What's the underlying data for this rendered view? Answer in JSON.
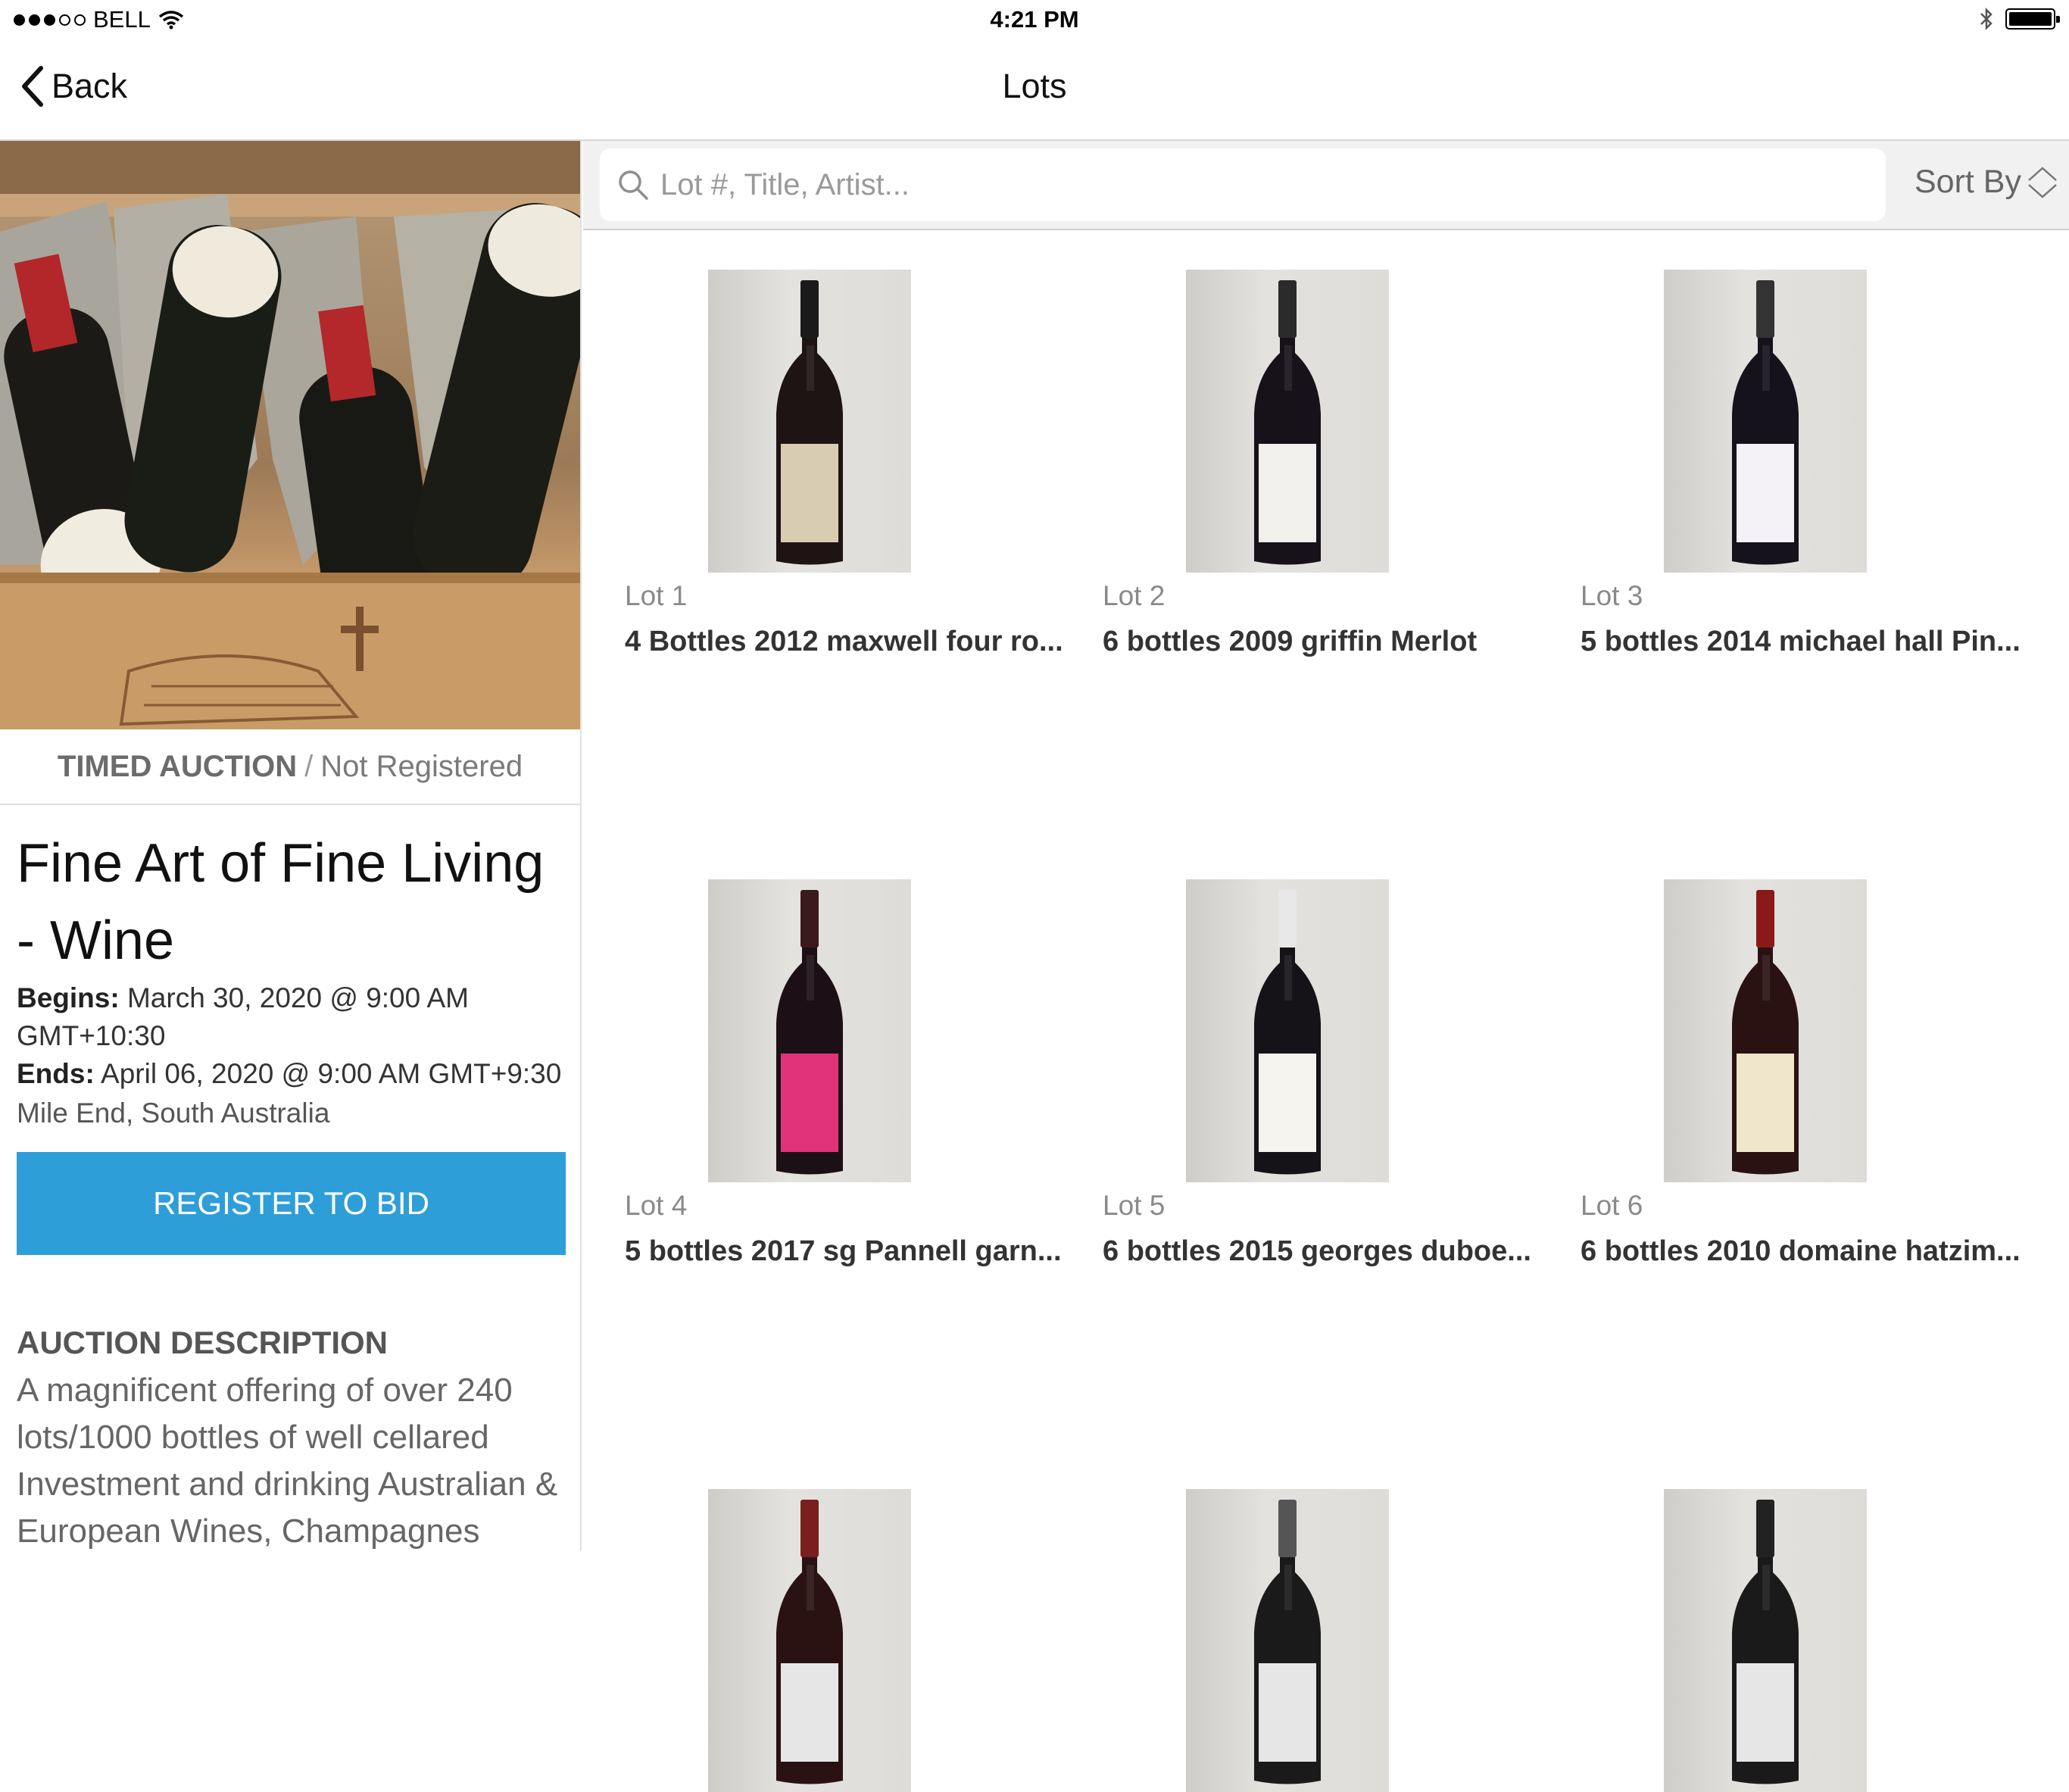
{
  "status_bar": {
    "carrier": "BELL",
    "time": "4:21 PM"
  },
  "nav": {
    "back_label": "Back",
    "title": "Lots"
  },
  "auction": {
    "type": "TIMED AUCTION",
    "separator": "/",
    "registration_status": "Not Registered",
    "title": "Fine Art of Fine Living - Wine",
    "begins_label": "Begins:",
    "begins_value": "March 30, 2020 @ 9:00 AM GMT+10:30",
    "ends_label": "Ends:",
    "ends_value": "April 06, 2020 @ 9:00 AM GMT+9:30",
    "location": "Mile End, South Australia",
    "register_button": "REGISTER TO BID",
    "description_heading": "AUCTION DESCRIPTION",
    "description": "A magnificent offering of over 240 lots/1000 bottles of well cellared Investment and drinking Australian & European Wines, Champagnes"
  },
  "search": {
    "placeholder": "Lot #, Title, Artist...",
    "value": ""
  },
  "sort": {
    "label": "Sort By"
  },
  "lots": [
    {
      "number": "Lot 1",
      "title": "4 Bottles 2012 maxwell four ro...",
      "cap_color": "#1a1a1a",
      "body_color": "#1e1414",
      "label_color": "#d8cdb2"
    },
    {
      "number": "Lot 2",
      "title": "6 bottles 2009 griffin Merlot",
      "cap_color": "#2a2a2a",
      "body_color": "#17121a",
      "label_color": "#f2f0ec"
    },
    {
      "number": "Lot 3",
      "title": "5 bottles 2014 michael hall Pin...",
      "cap_color": "#333333",
      "body_color": "#15121c",
      "label_color": "#f4f2f6"
    },
    {
      "number": "Lot 4",
      "title": "5 bottles 2017 sg Pannell garn...",
      "cap_color": "#3a1a1a",
      "body_color": "#1c1016",
      "label_color": "#e0337a"
    },
    {
      "number": "Lot 5",
      "title": "6 bottles 2015 georges duboe...",
      "cap_color": "#e8e8e8",
      "body_color": "#151218",
      "label_color": "#f6f4ef"
    },
    {
      "number": "Lot 6",
      "title": "6 bottles 2010 domaine hatzim...",
      "cap_color": "#8a1a1a",
      "body_color": "#2a1212",
      "label_color": "#efe6cc"
    },
    {
      "number": "",
      "title": "",
      "cap_color": "#7a1f1f",
      "body_color": "#2a1212",
      "label_color": "#e6e6e6"
    },
    {
      "number": "",
      "title": "",
      "cap_color": "#555555",
      "body_color": "#1a1a1a",
      "label_color": "#e6e6e6"
    },
    {
      "number": "",
      "title": "",
      "cap_color": "#222222",
      "body_color": "#1a1a1a",
      "label_color": "#e6e6e6"
    }
  ]
}
